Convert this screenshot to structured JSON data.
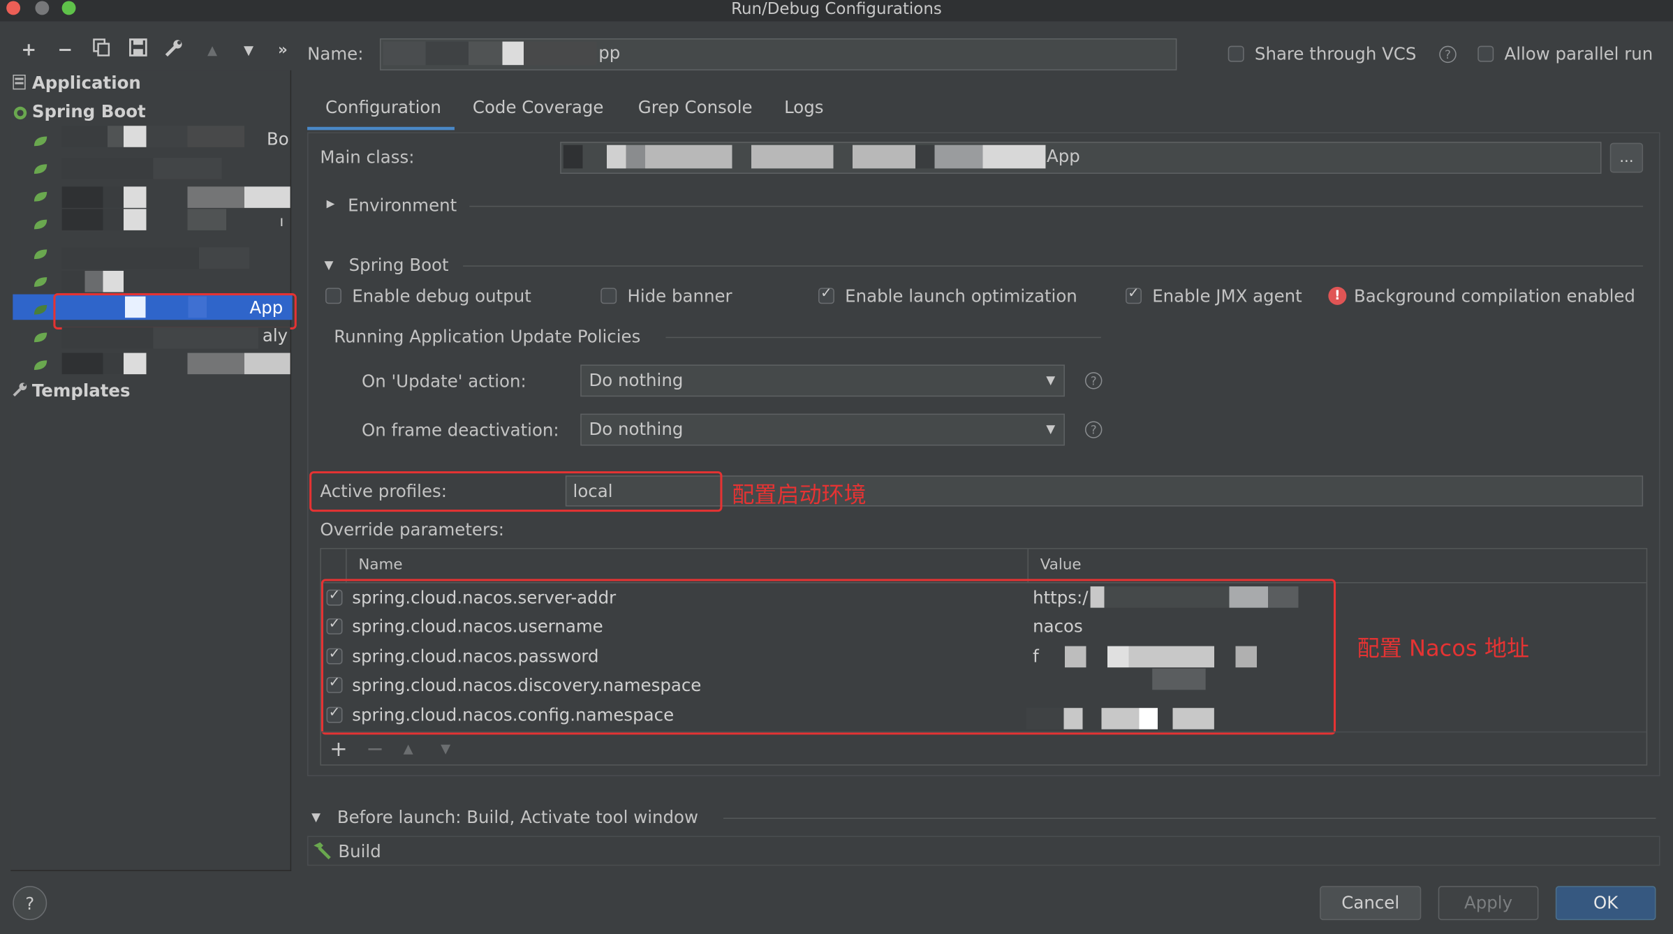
{
  "window": {
    "title": "Run/Debug Configurations"
  },
  "colors": {
    "selection": "#2f65ca",
    "annotation": "#e53333",
    "ok_button": "#365880",
    "spring_green": "#6aa84f"
  },
  "toolbar": {
    "add": "+",
    "remove": "−",
    "more": "»"
  },
  "tree": {
    "application": "Application",
    "spring_boot": "Spring Boot",
    "items": [
      "Bo",
      "",
      "",
      "ı",
      "",
      "",
      "App",
      "aly",
      ""
    ],
    "templates": "Templates"
  },
  "header": {
    "name_label": "Name:",
    "name_value": "pp",
    "share_vcs": "Share through VCS",
    "allow_parallel": "Allow parallel run"
  },
  "tabs": [
    "Configuration",
    "Code Coverage",
    "Grep Console",
    "Logs"
  ],
  "config": {
    "main_class_label": "Main class:",
    "main_class_value": "App",
    "browse": "...",
    "environment": "Environment",
    "spring_boot_section": "Spring Boot",
    "enable_debug": "Enable debug output",
    "hide_banner": "Hide banner",
    "enable_launch_opt": "Enable launch optimization",
    "enable_jmx": "Enable JMX agent",
    "bg_compile": "Background compilation enabled",
    "update_policies": "Running Application Update Policies",
    "on_update_label": "On 'Update' action:",
    "on_update_value": "Do nothing",
    "on_frame_label": "On frame deactivation:",
    "on_frame_value": "Do nothing",
    "active_profiles_label": "Active profiles:",
    "active_profiles_value": "local",
    "annotation_profiles": "配置启动环境",
    "override_label": "Override parameters:"
  },
  "override_table": {
    "col_name": "Name",
    "col_value": "Value",
    "rows": [
      {
        "name": "spring.cloud.nacos.server-addr",
        "value": "https:/"
      },
      {
        "name": "spring.cloud.nacos.username",
        "value": "nacos"
      },
      {
        "name": "spring.cloud.nacos.password",
        "value": "f"
      },
      {
        "name": "spring.cloud.nacos.discovery.namespace",
        "value": ""
      },
      {
        "name": "spring.cloud.nacos.config.namespace",
        "value": ""
      }
    ],
    "annotation": "配置 Nacos 地址",
    "add": "+",
    "remove": "−"
  },
  "before_launch": {
    "label": "Before launch: Build, Activate tool window",
    "build": "Build"
  },
  "footer": {
    "help": "?",
    "cancel": "Cancel",
    "apply": "Apply",
    "ok": "OK"
  }
}
